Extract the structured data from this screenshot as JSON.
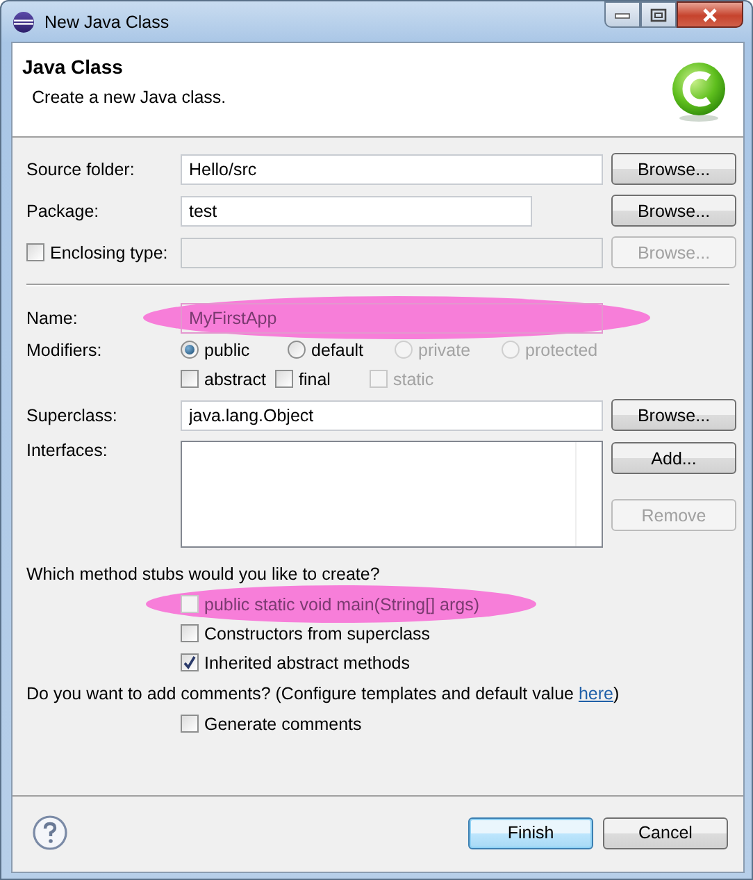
{
  "window": {
    "title": "New Java Class"
  },
  "header": {
    "title": "Java Class",
    "description": "Create a new Java class."
  },
  "source_folder": {
    "label": "Source folder:",
    "value": "Hello/src",
    "button": {
      "label": "Browse...",
      "disabled": false
    }
  },
  "package": {
    "label": "Package:",
    "value": "test",
    "button": {
      "label": "Browse...",
      "disabled": false
    }
  },
  "enclosing_type": {
    "label": "Enclosing type:",
    "checked": false,
    "disabled": true,
    "button": {
      "label": "Browse...",
      "disabled": true
    }
  },
  "name": {
    "label": "Name:",
    "value": "MyFirstApp",
    "highlighted": true
  },
  "modifiers": {
    "label": "Modifiers:",
    "access": [
      {
        "label": "public",
        "selected": true,
        "disabled": false
      },
      {
        "label": "default",
        "selected": false,
        "disabled": false
      },
      {
        "label": "private",
        "selected": false,
        "disabled": true
      },
      {
        "label": "protected",
        "selected": false,
        "disabled": true
      }
    ],
    "flags": [
      {
        "label": "abstract",
        "checked": false,
        "disabled": false
      },
      {
        "label": "final",
        "checked": false,
        "disabled": false
      },
      {
        "label": "static",
        "checked": false,
        "disabled": true
      }
    ]
  },
  "superclass": {
    "label": "Superclass:",
    "value": "java.lang.Object",
    "button": {
      "label": "Browse...",
      "disabled": false
    }
  },
  "interfaces": {
    "label": "Interfaces:",
    "buttons": [
      {
        "label": "Add...",
        "disabled": false
      },
      {
        "label": "Remove",
        "disabled": true
      }
    ]
  },
  "stubs": {
    "question": "Which method stubs would you like to create?",
    "options": [
      {
        "label": "public static void main(String[] args)",
        "checked": false,
        "disabled": true,
        "highlighted": true
      },
      {
        "label": "Constructors from superclass",
        "checked": false,
        "disabled": false,
        "highlighted": false
      },
      {
        "label": "Inherited abstract methods",
        "checked": true,
        "disabled": false,
        "highlighted": false
      }
    ]
  },
  "comments": {
    "text": "Do you want to add comments? (Configure templates and default value ",
    "link": "here",
    "text_after": ")",
    "option": {
      "label": "Generate comments",
      "checked": false
    }
  },
  "footer": {
    "buttons": [
      {
        "label": "Finish",
        "default": true
      },
      {
        "label": "Cancel",
        "default": false
      }
    ]
  }
}
